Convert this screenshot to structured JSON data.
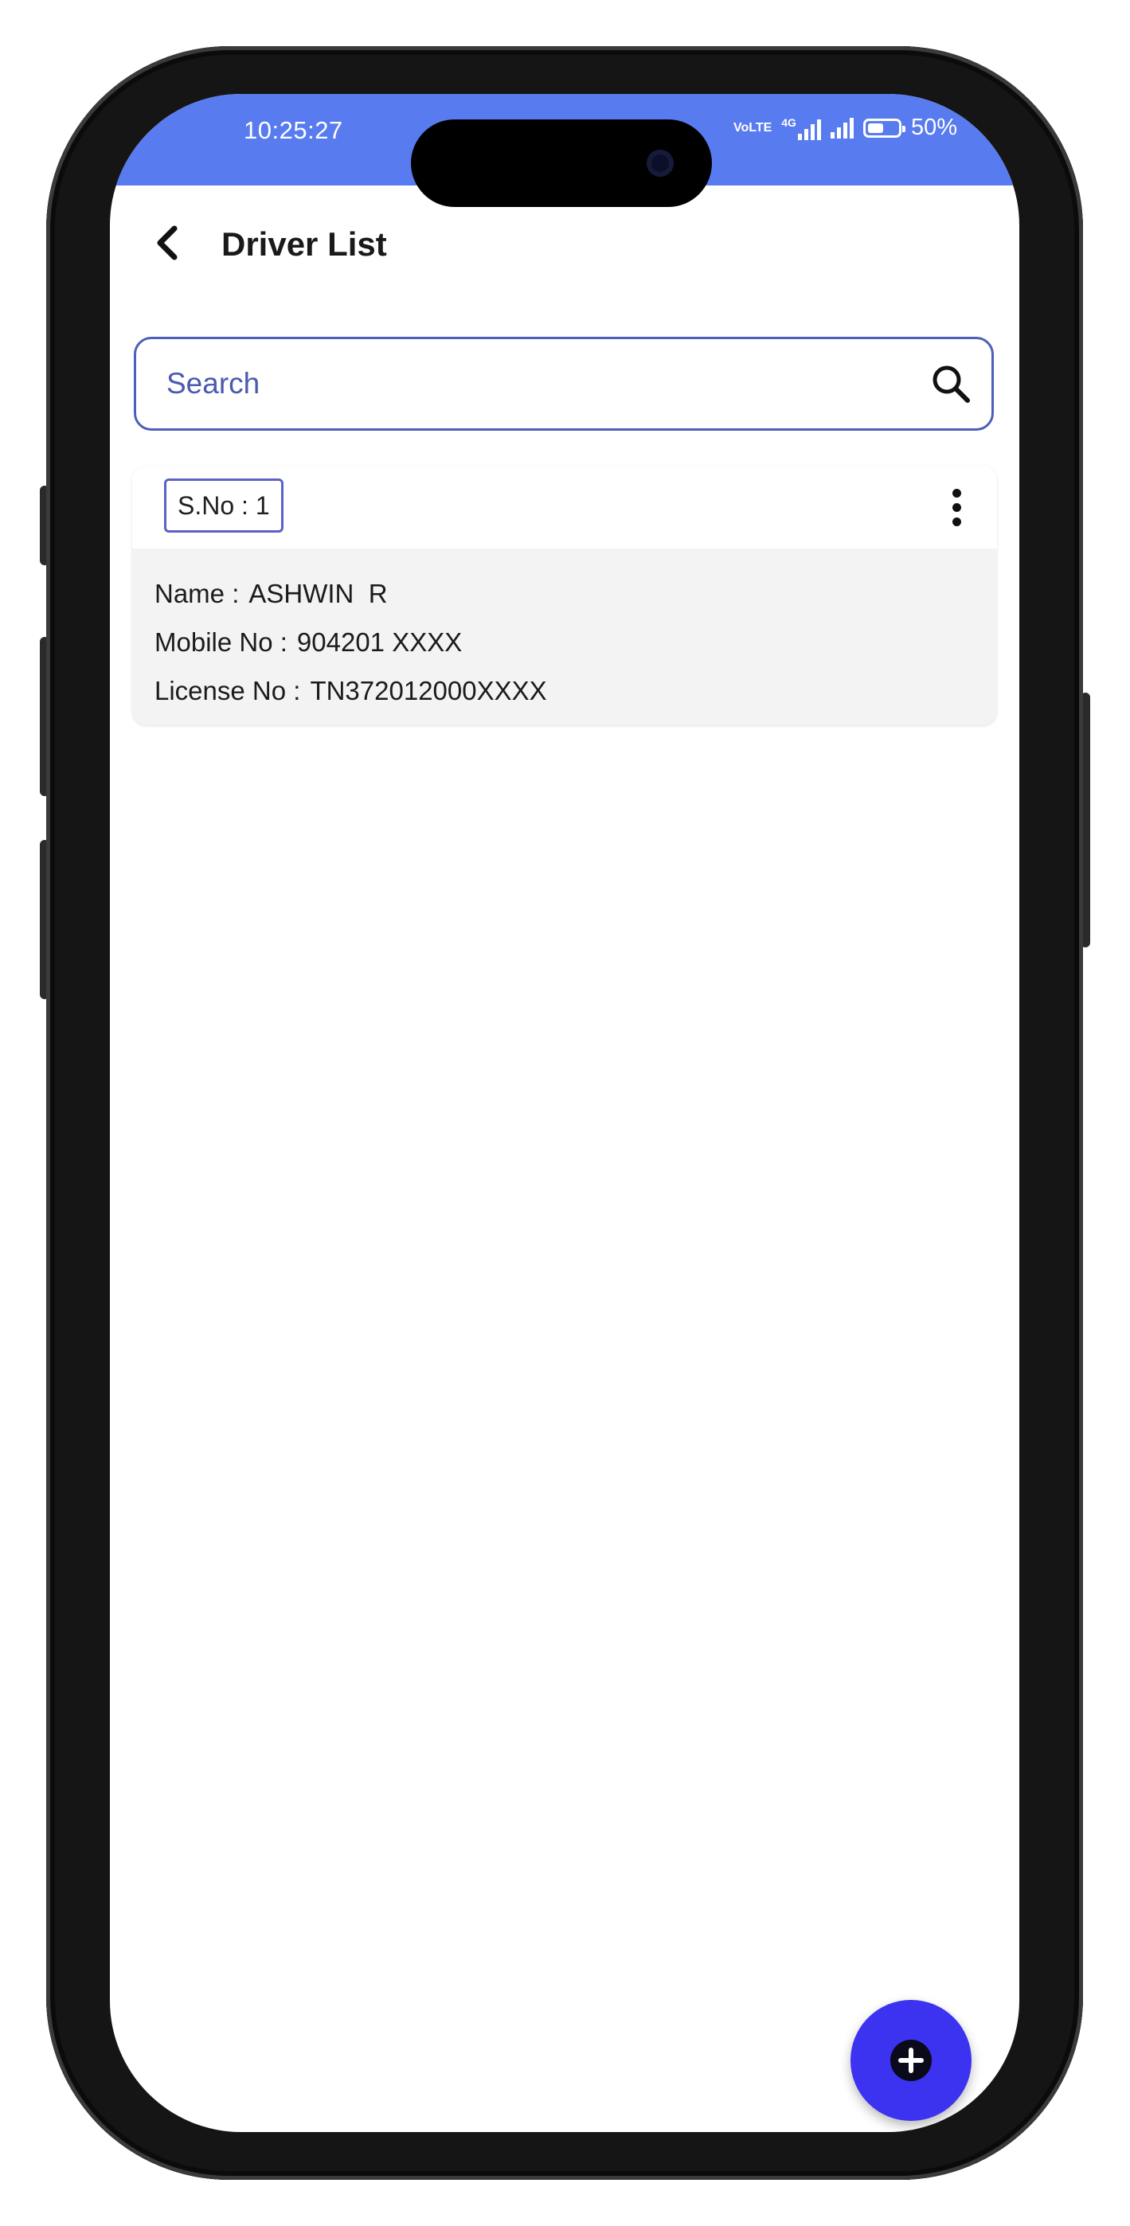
{
  "status_bar": {
    "time": "10:25:27",
    "network_label": "VoLTE",
    "network_type": "4G",
    "battery": "50%",
    "battery_level": 0.5,
    "color": "#587cf0"
  },
  "header": {
    "title": "Driver List",
    "back_icon": "chevron-left-icon"
  },
  "search": {
    "placeholder": "Search",
    "value": "",
    "icon": "search-icon"
  },
  "drivers": [
    {
      "serial": "S.No : 1",
      "name_label": "Name :",
      "name_value": "ASHWIN  R",
      "mobile_label": "Mobile No :",
      "mobile_value": "904201 XXXX",
      "license_label": "License No :",
      "license_value": "TN372012000XXXX",
      "menu_icon": "more-vertical-icon"
    }
  ],
  "fab": {
    "icon": "add-circle-icon",
    "color": "#3b33f0"
  }
}
